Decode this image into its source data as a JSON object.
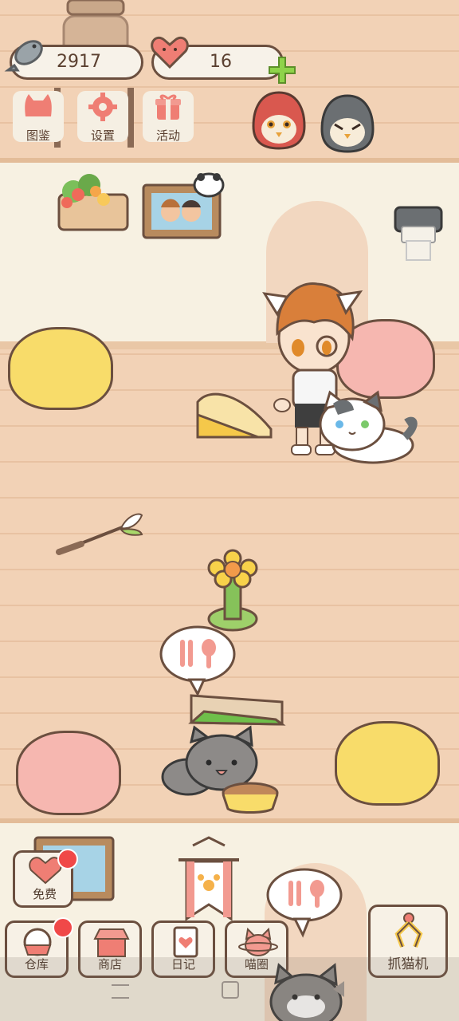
{
  "top_bar": {
    "fish_count": "2917",
    "heart_count": "16"
  },
  "top_buttons": {
    "collection_label": "图鉴",
    "settings_label": "设置",
    "events_label": "活动"
  },
  "free_button": {
    "label": "免费"
  },
  "bottom_buttons": {
    "warehouse_label": "仓库",
    "shop_label": "商店",
    "diary_label": "日记",
    "circle_label": "喵圈",
    "claw_machine_label": "抓猫机"
  },
  "icons": {
    "fish": "fish-icon",
    "heart": "heart-icon",
    "plus": "plus-icon",
    "cat_book": "cat-head-icon",
    "gear": "gear-icon",
    "gift": "gift-icon",
    "food_bubble": "fork-spoon-icon"
  },
  "colors": {
    "floor": "#f2d2b6",
    "wall": "#f7f1e2",
    "outline": "#6b4f3f",
    "accent_pink": "#ef7e74",
    "plus_green": "#8fd34a",
    "beanbag_yellow": "#f8dc6a",
    "beanbag_pink": "#f6b7b0"
  }
}
